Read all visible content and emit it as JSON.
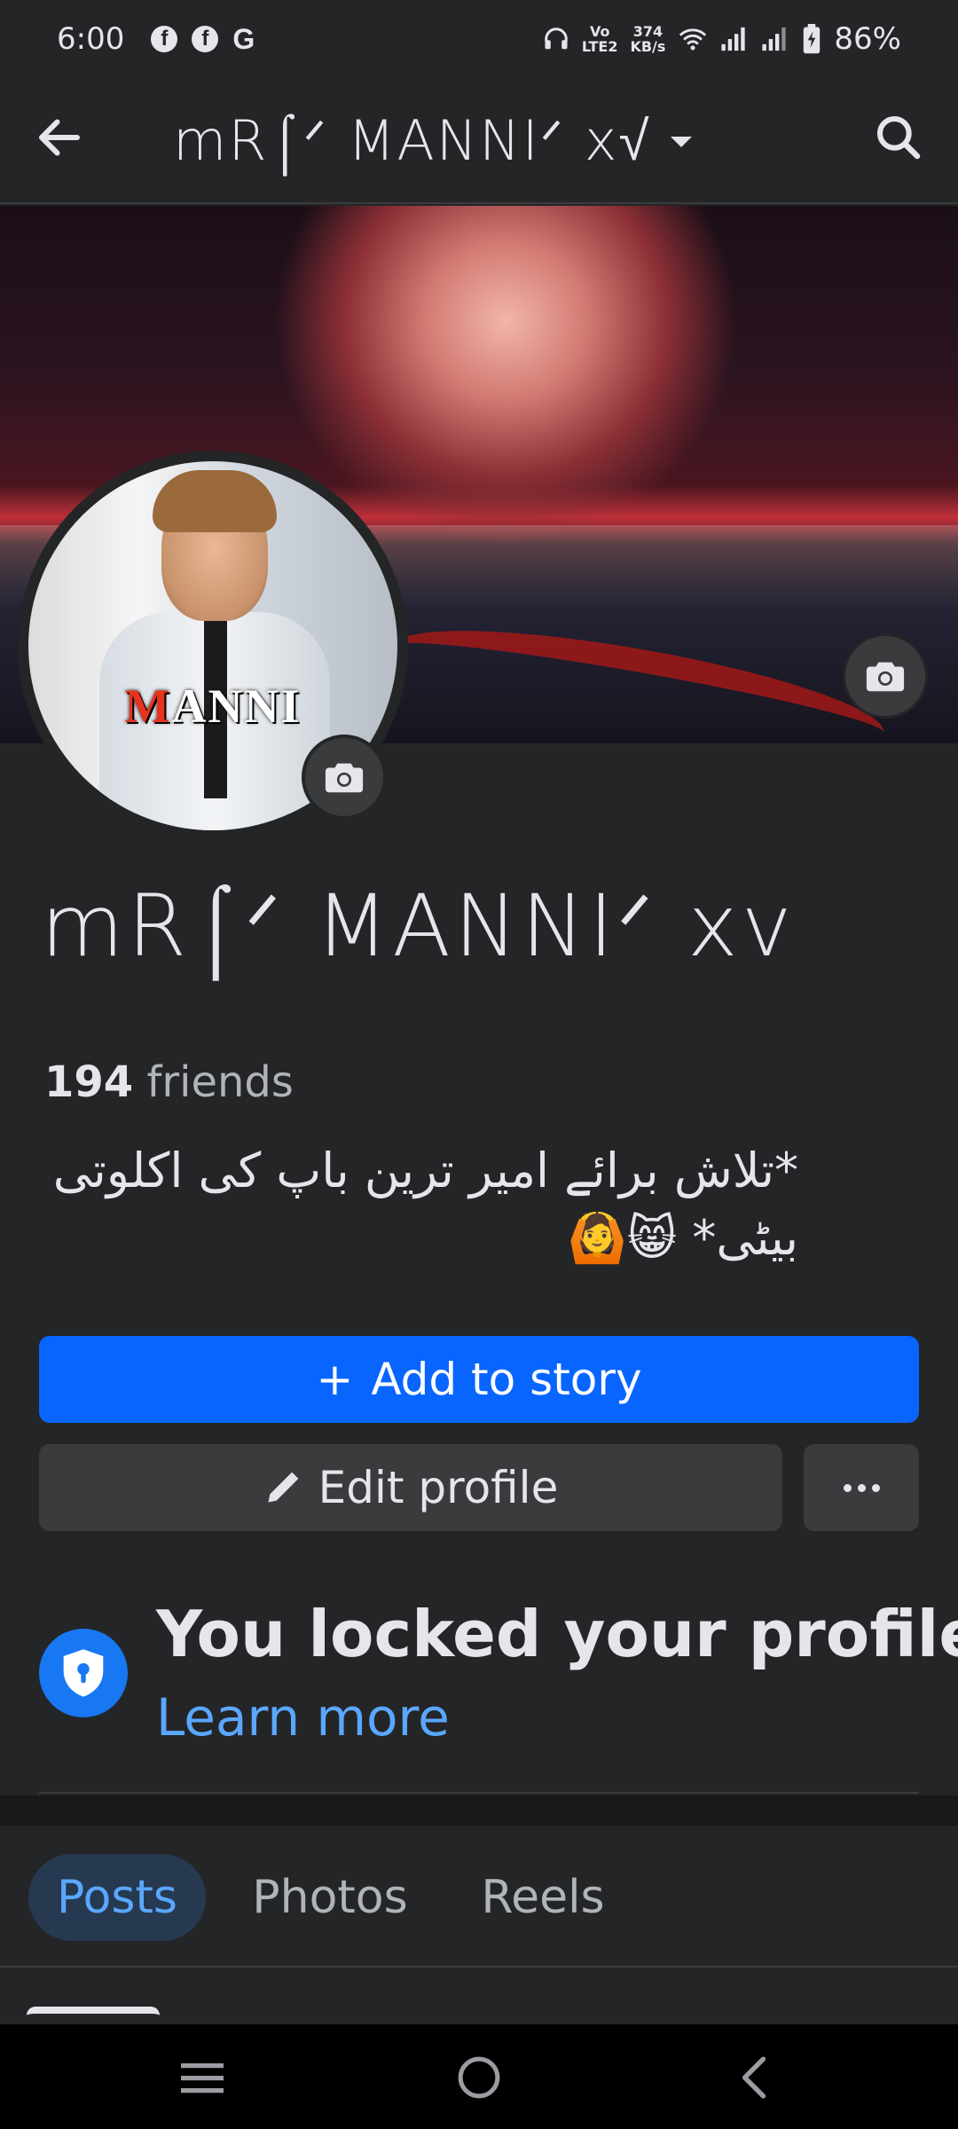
{
  "status_bar": {
    "time": "6:00",
    "left_icons": [
      "facebook-icon",
      "facebook-icon",
      "google-icon"
    ],
    "volte_line1": "Vo",
    "volte_line2": "LTE2",
    "net_speed_value": "374",
    "net_speed_unit": "KB/s",
    "battery": "86%"
  },
  "header": {
    "title": "mR⌠ᐟ MANNIᐟ x√"
  },
  "profile": {
    "name": "mR⌠ᐟ MANNIᐟ xv",
    "friends_count": "194",
    "friends_label": "friends",
    "bio": "*تلاش برائے امیر ترین باپ کی اکلوتی بیٹی* 😸🙆",
    "avatar_brand_first": "M",
    "avatar_brand_rest": "ANNI"
  },
  "actions": {
    "add_story": "Add to story",
    "add_story_icon": "+",
    "edit_profile": "Edit profile"
  },
  "locked": {
    "title": "You locked your profile",
    "learn_more": "Learn more"
  },
  "tabs": [
    {
      "label": "Posts",
      "active": true
    },
    {
      "label": "Photos",
      "active": false
    },
    {
      "label": "Reels",
      "active": false
    }
  ],
  "colors": {
    "background": "#242526",
    "primary_button": "#0866ff",
    "secondary_button": "#3a3b3c",
    "link": "#5aa7ff",
    "active_tab_bg": "#263951",
    "lock_badge": "#1877f2"
  }
}
